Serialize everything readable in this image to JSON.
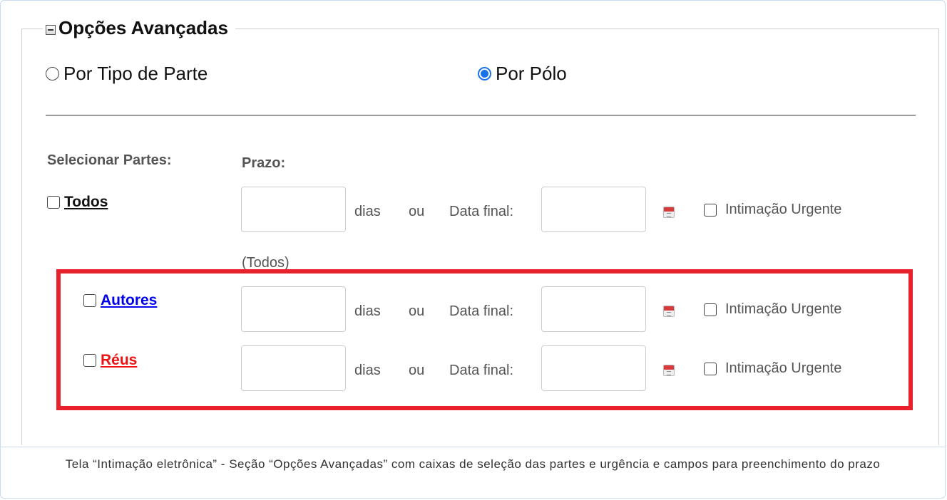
{
  "section": {
    "title": "Opções Avançadas",
    "radio_tipo_parte": "Por Tipo de Parte",
    "radio_polo": "Por Pólo",
    "selected_radio": "Por Pólo"
  },
  "headers": {
    "parts": "Selecionar Partes:",
    "deadline": "Prazo:"
  },
  "rows": [
    {
      "party": "Todos",
      "party_color": "#111111",
      "days_label": "dias",
      "or_label": "ou",
      "final_date_label": "Data final:",
      "urgent_label": "Intimação Urgente"
    },
    {
      "party": "Autores",
      "party_color": "#0000ee",
      "days_label": "dias",
      "or_label": "ou",
      "final_date_label": "Data final:",
      "urgent_label": "Intimação Urgente"
    },
    {
      "party": "Réus",
      "party_color": "#ee1111",
      "days_label": "dias",
      "or_label": "ou",
      "final_date_label": "Data final:",
      "urgent_label": "Intimação Urgente"
    }
  ],
  "todos_note": "(Todos)",
  "highlight_color": "#e8212c",
  "caption": "Tela “Intimação eletrônica” - Seção “Opções Avançadas” com caixas de seleção das partes e urgência e campos para preenchimento do prazo"
}
